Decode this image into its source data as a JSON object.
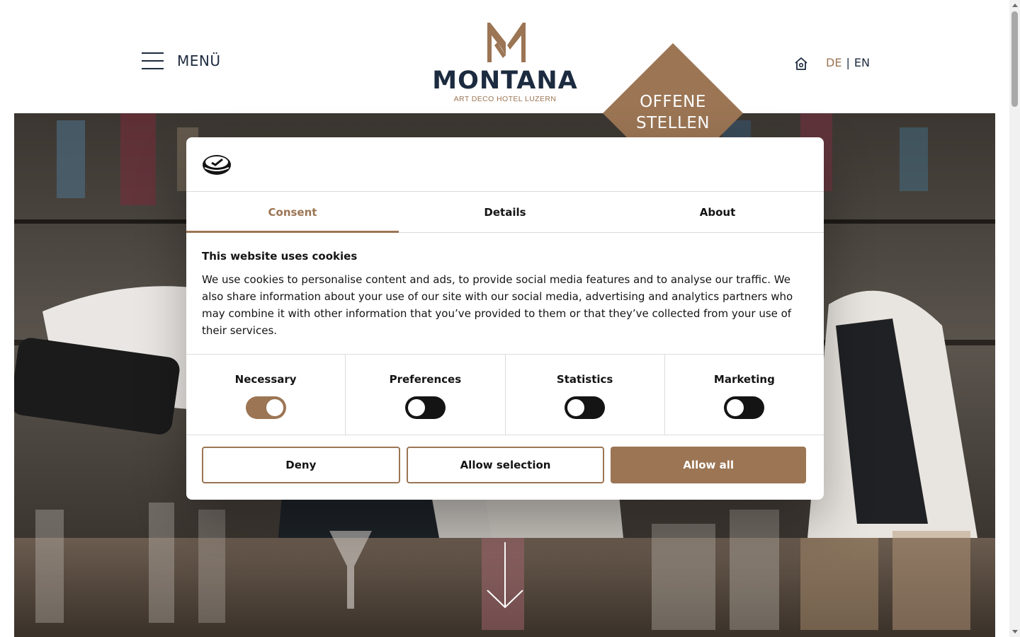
{
  "header": {
    "menu_label": "MENÜ",
    "logo_name": "MONTANA",
    "logo_sub": "ART DECO HOTEL LUZERN",
    "jobs_line1": "OFFENE",
    "jobs_line2": "STELLEN",
    "lang_active": "DE",
    "lang_separator": "|",
    "lang_other": "EN"
  },
  "icons": {
    "menu": "hamburger-icon",
    "home": "home-icon",
    "cookiebot": "cookiebot-logo",
    "scroll": "arrow-down-icon"
  },
  "cookie_dialog": {
    "tabs": [
      "Consent",
      "Details",
      "About"
    ],
    "active_tab": "Consent",
    "title": "This website uses cookies",
    "text": "We use cookies to personalise content and ads, to provide social media features and to analyse our traffic. We also share information about your use of our site with our social media, advertising and analytics partners who may combine it with other information that you’ve provided to them or that they’ve collected from your use of their services.",
    "toggles": [
      {
        "label": "Necessary",
        "checked": true
      },
      {
        "label": "Preferences",
        "checked": false
      },
      {
        "label": "Statistics",
        "checked": false
      },
      {
        "label": "Marketing",
        "checked": false
      }
    ],
    "buttons": {
      "deny": "Deny",
      "allow_selection": "Allow selection",
      "allow_all": "Allow all"
    }
  },
  "colors": {
    "accent": "#9b7554",
    "navy": "#1c2b3f",
    "text": "#141414"
  }
}
